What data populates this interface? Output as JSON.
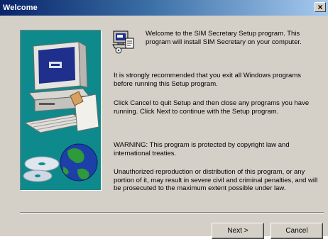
{
  "window": {
    "title": "Welcome",
    "close_label": "×"
  },
  "content": {
    "intro": "Welcome to the SIM Secretary Setup program.  This program will install SIM Secretary on your computer.",
    "paragraphs": [
      "It is strongly recommended that you exit all Windows programs before running this Setup program.",
      "Click Cancel to quit Setup and then close any programs you have running.  Click Next to continue with the Setup program.",
      "WARNING: This program is protected by copyright law and international treaties.",
      "Unauthorized reproduction or distribution of this program, or any portion of it, may result in severe civil and criminal penalties, and will be prosecuted to the maximum extent possible under law."
    ]
  },
  "buttons": {
    "next": "Next >",
    "cancel": "Cancel"
  },
  "icons": {
    "setup": "setup-computer-icon",
    "art": "computer-globe-cd-illustration"
  },
  "colors": {
    "title_bar_start": "#0a246a",
    "title_bar_end": "#a6caf0",
    "panel_background": "#0e8a8d",
    "dialog_face": "#d4d0c8"
  }
}
